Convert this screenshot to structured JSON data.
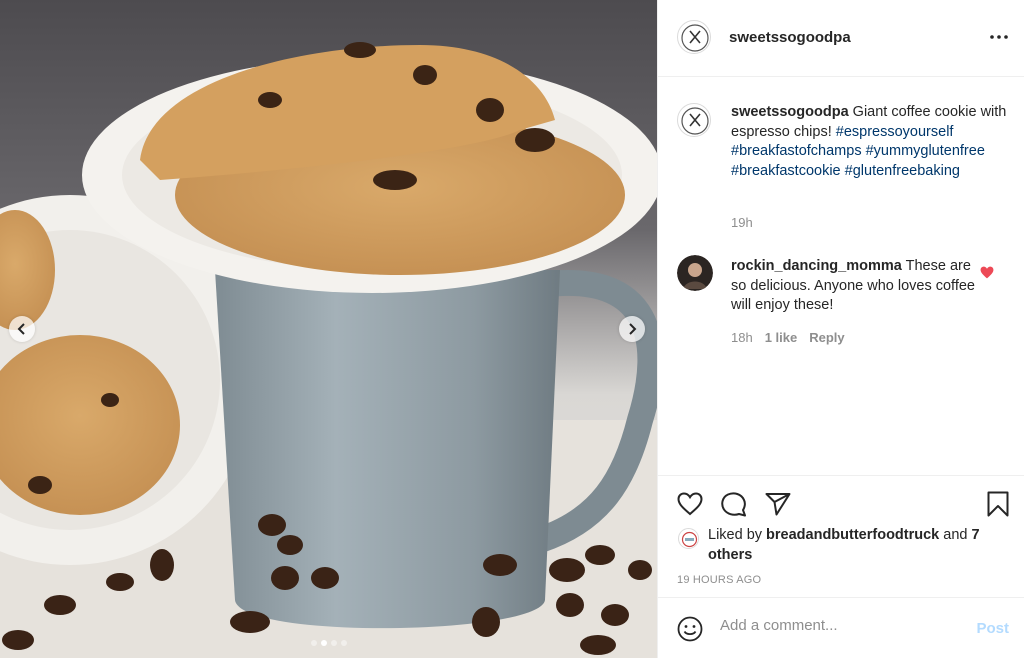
{
  "post": {
    "username": "sweetssogoodpa",
    "more_icon": "more-horizontal-icon",
    "photo_alt": "Giant coffee cookie on a saucer atop a grey mug with coffee beans",
    "carousel": {
      "count": 4,
      "active_index": 1
    }
  },
  "caption": {
    "username": "sweetssogoodpa",
    "text": "Giant coffee cookie with espresso chips!",
    "hashtags": [
      "#espressoyourself",
      "#breakfastofchamps",
      "#yummyglutenfree",
      "#breakfastcookie",
      "#glutenfreebaking"
    ],
    "time": "19h"
  },
  "comment": {
    "username": "rockin_dancing_momma",
    "text": "These are so delicious. Anyone who loves coffee will enjoy these!",
    "time": "18h",
    "likes": "1 like",
    "reply": "Reply",
    "liked_color": "#ed4956"
  },
  "likes": {
    "prefix": "Liked by",
    "user": "breadandbutterfoodtruck",
    "joiner": "and",
    "others": "7 others"
  },
  "timestamp": "19 HOURS AGO",
  "add_comment": {
    "placeholder": "Add a comment...",
    "post_label": "Post",
    "post_color": "#b3dbff"
  }
}
